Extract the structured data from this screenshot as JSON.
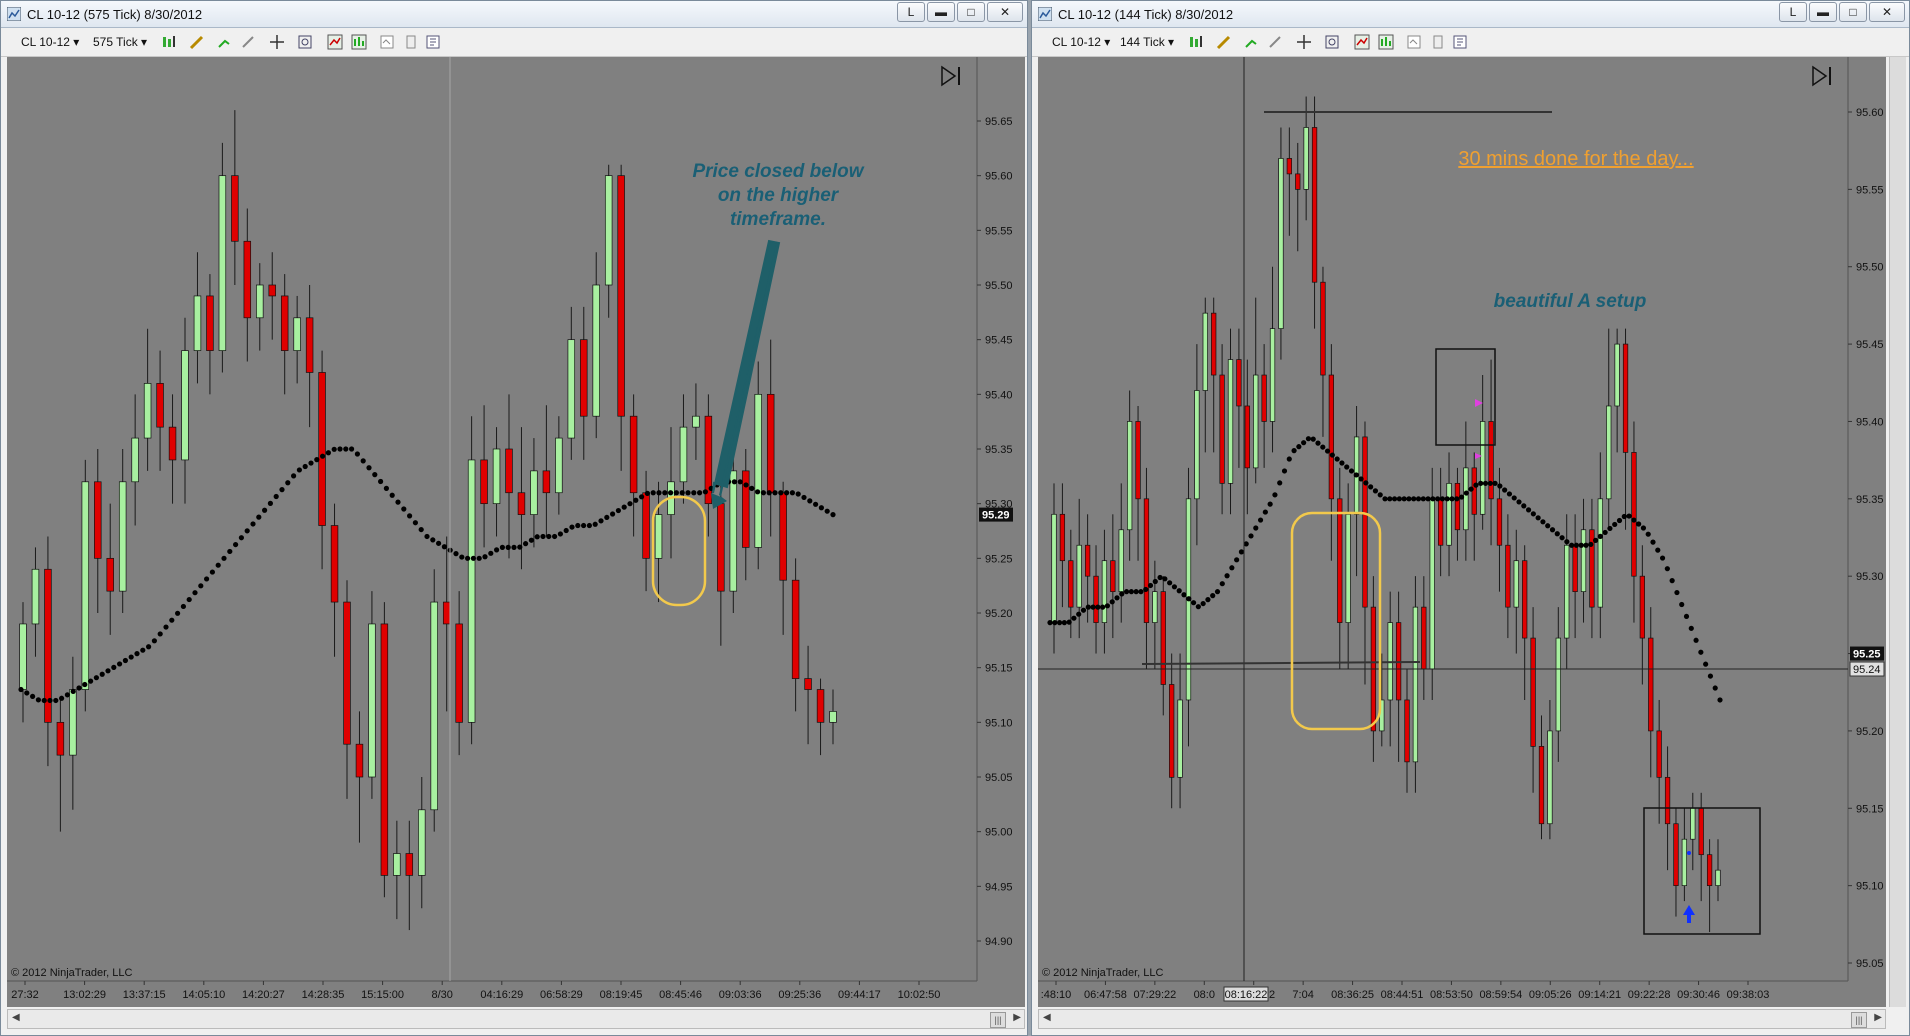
{
  "left": {
    "title": "CL 10-12 (575 Tick)  8/30/2012",
    "tb_instrument": "CL 10-12",
    "tb_interval": "575 Tick",
    "btn_l": "L",
    "btn_min": "▬",
    "btn_max": "□",
    "btn_close": "✕",
    "copyright": "© 2012 NinjaTrader, LLC",
    "annotation": [
      "Price closed below",
      "on the higher",
      "timeframe."
    ],
    "last_price": "95.29",
    "scroll_label": "|||"
  },
  "right": {
    "title": "CL 10-12 (144 Tick)  8/30/2012",
    "tb_instrument": "CL 10-12",
    "tb_interval": "144 Tick",
    "btn_l": "L",
    "btn_min": "▬",
    "btn_max": "□",
    "btn_close": "✕",
    "copyright": "© 2012 NinjaTrader, LLC",
    "note_top": "30 mins done for the day...",
    "note_mid": "beautiful A setup",
    "last_price": "95.25",
    "crosshair_price": "95.24",
    "crosshair_time": "08:16:22",
    "scroll_label": "|||"
  },
  "chart_data": [
    {
      "type": "candlestick",
      "instrument": "CL 10-12",
      "interval": "575 Tick",
      "date": "8/30/2012",
      "ylim": [
        94.85,
        95.72
      ],
      "yticks": [
        "95.65",
        "95.60",
        "95.55",
        "95.50",
        "95.45",
        "95.40",
        "95.35",
        "95.30",
        "95.25",
        "95.20",
        "95.15",
        "95.10",
        "95.05",
        "95.00",
        "94.95",
        "94.90"
      ],
      "xticks": [
        "27:32",
        "13:02:29",
        "13:37:15",
        "14:05:10",
        "14:20:27",
        "14:28:35",
        "15:15:00",
        "8/30",
        "04:16:29",
        "06:58:29",
        "08:19:45",
        "08:45:46",
        "09:03:36",
        "09:25:36",
        "09:44:17",
        "10:02:50"
      ],
      "last_price": 95.29,
      "candles": [
        [
          95.13,
          95.19,
          95.21,
          95.1
        ],
        [
          95.19,
          95.24,
          95.26,
          95.16
        ],
        [
          95.24,
          95.1,
          95.27,
          95.06
        ],
        [
          95.1,
          95.07,
          95.12,
          95.0
        ],
        [
          95.07,
          95.13,
          95.16,
          95.02
        ],
        [
          95.13,
          95.32,
          95.34,
          95.11
        ],
        [
          95.32,
          95.25,
          95.35,
          95.2
        ],
        [
          95.25,
          95.22,
          95.3,
          95.18
        ],
        [
          95.22,
          95.32,
          95.35,
          95.2
        ],
        [
          95.32,
          95.36,
          95.4,
          95.28
        ],
        [
          95.36,
          95.41,
          95.46,
          95.33
        ],
        [
          95.41,
          95.37,
          95.44,
          95.33
        ],
        [
          95.37,
          95.34,
          95.4,
          95.3
        ],
        [
          95.34,
          95.44,
          95.47,
          95.3
        ],
        [
          95.44,
          95.49,
          95.53,
          95.41
        ],
        [
          95.49,
          95.44,
          95.51,
          95.4
        ],
        [
          95.44,
          95.6,
          95.63,
          95.42
        ],
        [
          95.6,
          95.54,
          95.66,
          95.5
        ],
        [
          95.54,
          95.47,
          95.57,
          95.43
        ],
        [
          95.47,
          95.5,
          95.52,
          95.44
        ],
        [
          95.5,
          95.49,
          95.53,
          95.45
        ],
        [
          95.49,
          95.44,
          95.51,
          95.4
        ],
        [
          95.44,
          95.47,
          95.49,
          95.41
        ],
        [
          95.47,
          95.42,
          95.5,
          95.37
        ],
        [
          95.42,
          95.28,
          95.44,
          95.24
        ],
        [
          95.28,
          95.21,
          95.3,
          95.16
        ],
        [
          95.21,
          95.08,
          95.23,
          95.03
        ],
        [
          95.08,
          95.05,
          95.11,
          94.99
        ],
        [
          95.05,
          95.19,
          95.22,
          95.03
        ],
        [
          95.19,
          94.96,
          95.21,
          94.94
        ],
        [
          94.96,
          94.98,
          95.01,
          94.92
        ],
        [
          94.98,
          94.96,
          95.01,
          94.91
        ],
        [
          94.96,
          95.02,
          95.05,
          94.93
        ],
        [
          95.02,
          95.21,
          95.24,
          95.0
        ],
        [
          95.21,
          95.19,
          95.27,
          95.11
        ],
        [
          95.19,
          95.1,
          95.22,
          95.07
        ],
        [
          95.1,
          95.34,
          95.38,
          95.08
        ],
        [
          95.34,
          95.3,
          95.39,
          95.26
        ],
        [
          95.3,
          95.35,
          95.37,
          95.27
        ],
        [
          95.35,
          95.31,
          95.4,
          95.25
        ],
        [
          95.31,
          95.29,
          95.37,
          95.24
        ],
        [
          95.29,
          95.33,
          95.36,
          95.26
        ],
        [
          95.33,
          95.31,
          95.39,
          95.27
        ],
        [
          95.31,
          95.36,
          95.38,
          95.29
        ],
        [
          95.36,
          95.45,
          95.48,
          95.34
        ],
        [
          95.45,
          95.38,
          95.48,
          95.34
        ],
        [
          95.38,
          95.5,
          95.53,
          95.36
        ],
        [
          95.5,
          95.6,
          95.61,
          95.47
        ],
        [
          95.6,
          95.38,
          95.61,
          95.33
        ],
        [
          95.38,
          95.31,
          95.4,
          95.27
        ],
        [
          95.31,
          95.25,
          95.33,
          95.22
        ],
        [
          95.25,
          95.29,
          95.32,
          95.21
        ],
        [
          95.29,
          95.32,
          95.37,
          95.25
        ],
        [
          95.32,
          95.37,
          95.4,
          95.3
        ],
        [
          95.37,
          95.38,
          95.41,
          95.34
        ],
        [
          95.38,
          95.3,
          95.4,
          95.27
        ],
        [
          95.3,
          95.22,
          95.34,
          95.17
        ],
        [
          95.22,
          95.33,
          95.36,
          95.2
        ],
        [
          95.33,
          95.26,
          95.35,
          95.23
        ],
        [
          95.26,
          95.4,
          95.43,
          95.24
        ],
        [
          95.4,
          95.31,
          95.45,
          95.27
        ],
        [
          95.31,
          95.23,
          95.32,
          95.18
        ],
        [
          95.23,
          95.14,
          95.25,
          95.11
        ],
        [
          95.14,
          95.13,
          95.17,
          95.08
        ],
        [
          95.13,
          95.1,
          95.14,
          95.07
        ],
        [
          95.1,
          95.11,
          95.13,
          95.08
        ]
      ],
      "ema": [
        95.13,
        95.12,
        95.12,
        95.13,
        95.14,
        95.15,
        95.16,
        95.17,
        95.19,
        95.21,
        95.23,
        95.25,
        95.27,
        95.29,
        95.31,
        95.33,
        95.34,
        95.35,
        95.35,
        95.33,
        95.31,
        95.29,
        95.27,
        95.26,
        95.25,
        95.25,
        95.26,
        95.26,
        95.27,
        95.27,
        95.28,
        95.28,
        95.29,
        95.3,
        95.31,
        95.31,
        95.31,
        95.31,
        95.32,
        95.32,
        95.31,
        95.31,
        95.31,
        95.3,
        95.29
      ]
    },
    {
      "type": "candlestick",
      "instrument": "CL 10-12",
      "interval": "144 Tick",
      "date": "8/30/2012",
      "ylim": [
        95.04,
        95.62
      ],
      "yticks": [
        "95.60",
        "95.55",
        "95.50",
        "95.45",
        "95.40",
        "95.35",
        "95.30",
        "95.25",
        "95.20",
        "95.15",
        "95.10",
        "95.05"
      ],
      "xticks": [
        ":48:10",
        "06:47:58",
        "07:29:22",
        "08:0",
        "08:16:22",
        "7:04",
        "08:36:25",
        "08:44:51",
        "08:53:50",
        "08:59:54",
        "09:05:26",
        "09:14:21",
        "09:22:28",
        "09:30:46",
        "09:38:03"
      ],
      "last_price": 95.25,
      "crosshair_price": 95.24,
      "candles": [
        [
          95.27,
          95.34,
          95.36,
          95.25
        ],
        [
          95.34,
          95.31,
          95.36,
          95.28
        ],
        [
          95.31,
          95.28,
          95.33,
          95.26
        ],
        [
          95.28,
          95.32,
          95.35,
          95.26
        ],
        [
          95.32,
          95.3,
          95.34,
          95.27
        ],
        [
          95.3,
          95.27,
          95.32,
          95.25
        ],
        [
          95.27,
          95.31,
          95.33,
          95.25
        ],
        [
          95.31,
          95.29,
          95.34,
          95.26
        ],
        [
          95.29,
          95.33,
          95.36,
          95.27
        ],
        [
          95.33,
          95.4,
          95.42,
          95.31
        ],
        [
          95.4,
          95.35,
          95.41,
          95.31
        ],
        [
          95.35,
          95.27,
          95.37,
          95.24
        ],
        [
          95.27,
          95.29,
          95.31,
          95.24
        ],
        [
          95.29,
          95.23,
          95.3,
          95.21
        ],
        [
          95.23,
          95.17,
          95.25,
          95.15
        ],
        [
          95.17,
          95.22,
          95.25,
          95.15
        ],
        [
          95.22,
          95.35,
          95.37,
          95.19
        ],
        [
          95.35,
          95.42,
          95.45,
          95.32
        ],
        [
          95.42,
          95.47,
          95.48,
          95.38
        ],
        [
          95.47,
          95.43,
          95.48,
          95.38
        ],
        [
          95.43,
          95.36,
          95.45,
          95.34
        ],
        [
          95.36,
          95.44,
          95.46,
          95.34
        ],
        [
          95.44,
          95.41,
          95.46,
          95.37
        ],
        [
          95.41,
          95.37,
          95.44,
          95.34
        ],
        [
          95.37,
          95.43,
          95.48,
          95.36
        ],
        [
          95.43,
          95.4,
          95.45,
          95.37
        ],
        [
          95.4,
          95.46,
          95.5,
          95.38
        ],
        [
          95.46,
          95.57,
          95.59,
          95.44
        ],
        [
          95.57,
          95.56,
          95.59,
          95.52
        ],
        [
          95.56,
          95.55,
          95.58,
          95.51
        ],
        [
          95.55,
          95.59,
          95.61,
          95.53
        ],
        [
          95.59,
          95.49,
          95.61,
          95.46
        ],
        [
          95.49,
          95.43,
          95.5,
          95.39
        ],
        [
          95.43,
          95.35,
          95.45,
          95.31
        ],
        [
          95.35,
          95.27,
          95.37,
          95.24
        ],
        [
          95.27,
          95.34,
          95.36,
          95.24
        ],
        [
          95.34,
          95.39,
          95.41,
          95.3
        ],
        [
          95.39,
          95.28,
          95.4,
          95.23
        ],
        [
          95.28,
          95.2,
          95.3,
          95.18
        ],
        [
          95.2,
          95.22,
          95.25,
          95.19
        ],
        [
          95.22,
          95.27,
          95.29,
          95.19
        ],
        [
          95.27,
          95.22,
          95.29,
          95.18
        ],
        [
          95.22,
          95.18,
          95.24,
          95.16
        ],
        [
          95.18,
          95.28,
          95.3,
          95.16
        ],
        [
          95.28,
          95.24,
          95.3,
          95.22
        ],
        [
          95.24,
          95.35,
          95.37,
          95.22
        ],
        [
          95.35,
          95.32,
          95.37,
          95.3
        ],
        [
          95.32,
          95.36,
          95.38,
          95.3
        ],
        [
          95.36,
          95.33,
          95.37,
          95.31
        ],
        [
          95.33,
          95.37,
          95.4,
          95.31
        ],
        [
          95.37,
          95.34,
          95.38,
          95.31
        ],
        [
          95.34,
          95.4,
          95.43,
          95.33
        ],
        [
          95.4,
          95.35,
          95.44,
          95.32
        ],
        [
          95.35,
          95.32,
          95.37,
          95.29
        ],
        [
          95.32,
          95.28,
          95.34,
          95.26
        ],
        [
          95.28,
          95.31,
          95.33,
          95.25
        ],
        [
          95.31,
          95.26,
          95.32,
          95.22
        ],
        [
          95.26,
          95.19,
          95.28,
          95.16
        ],
        [
          95.19,
          95.14,
          95.21,
          95.13
        ],
        [
          95.14,
          95.2,
          95.22,
          95.13
        ],
        [
          95.2,
          95.26,
          95.28,
          95.18
        ],
        [
          95.26,
          95.32,
          95.34,
          95.24
        ],
        [
          95.32,
          95.29,
          95.34,
          95.26
        ],
        [
          95.29,
          95.33,
          95.35,
          95.27
        ],
        [
          95.33,
          95.28,
          95.35,
          95.26
        ],
        [
          95.28,
          95.35,
          95.38,
          95.26
        ],
        [
          95.35,
          95.41,
          95.46,
          95.33
        ],
        [
          95.41,
          95.45,
          95.46,
          95.38
        ],
        [
          95.45,
          95.38,
          95.46,
          95.33
        ],
        [
          95.38,
          95.3,
          95.4,
          95.27
        ],
        [
          95.3,
          95.26,
          95.32,
          95.23
        ],
        [
          95.26,
          95.2,
          95.28,
          95.17
        ],
        [
          95.2,
          95.17,
          95.22,
          95.14
        ],
        [
          95.17,
          95.14,
          95.19,
          95.11
        ],
        [
          95.14,
          95.1,
          95.15,
          95.08
        ],
        [
          95.1,
          95.13,
          95.15,
          95.09
        ],
        [
          95.13,
          95.15,
          95.16,
          95.11
        ],
        [
          95.15,
          95.12,
          95.16,
          95.09
        ],
        [
          95.12,
          95.1,
          95.13,
          95.07
        ],
        [
          95.1,
          95.11,
          95.13,
          95.09
        ]
      ],
      "ema": [
        95.27,
        95.27,
        95.28,
        95.28,
        95.29,
        95.29,
        95.3,
        95.29,
        95.28,
        95.29,
        95.31,
        95.33,
        95.35,
        95.38,
        95.39,
        95.38,
        95.37,
        95.36,
        95.35,
        95.35,
        95.35,
        95.35,
        95.35,
        95.36,
        95.36,
        95.35,
        95.34,
        95.33,
        95.32,
        95.32,
        95.33,
        95.34,
        95.33,
        95.31,
        95.28,
        95.25,
        95.22
      ]
    }
  ]
}
